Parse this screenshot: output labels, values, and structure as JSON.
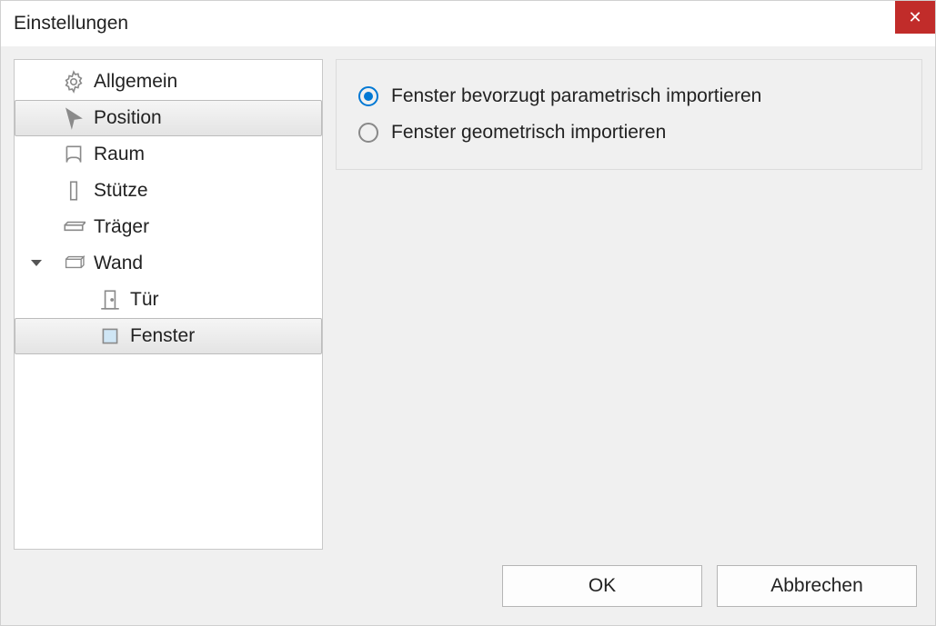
{
  "title": "Einstellungen",
  "tree": {
    "items": [
      {
        "label": "Allgemein"
      },
      {
        "label": "Position"
      },
      {
        "label": "Raum"
      },
      {
        "label": "Stütze"
      },
      {
        "label": "Träger"
      },
      {
        "label": "Wand"
      },
      {
        "label": "Tür"
      },
      {
        "label": "Fenster"
      }
    ]
  },
  "options": {
    "radio1": "Fenster bevorzugt parametrisch importieren",
    "radio2": "Fenster geometrisch importieren"
  },
  "buttons": {
    "ok": "OK",
    "cancel": "Abbrechen"
  }
}
